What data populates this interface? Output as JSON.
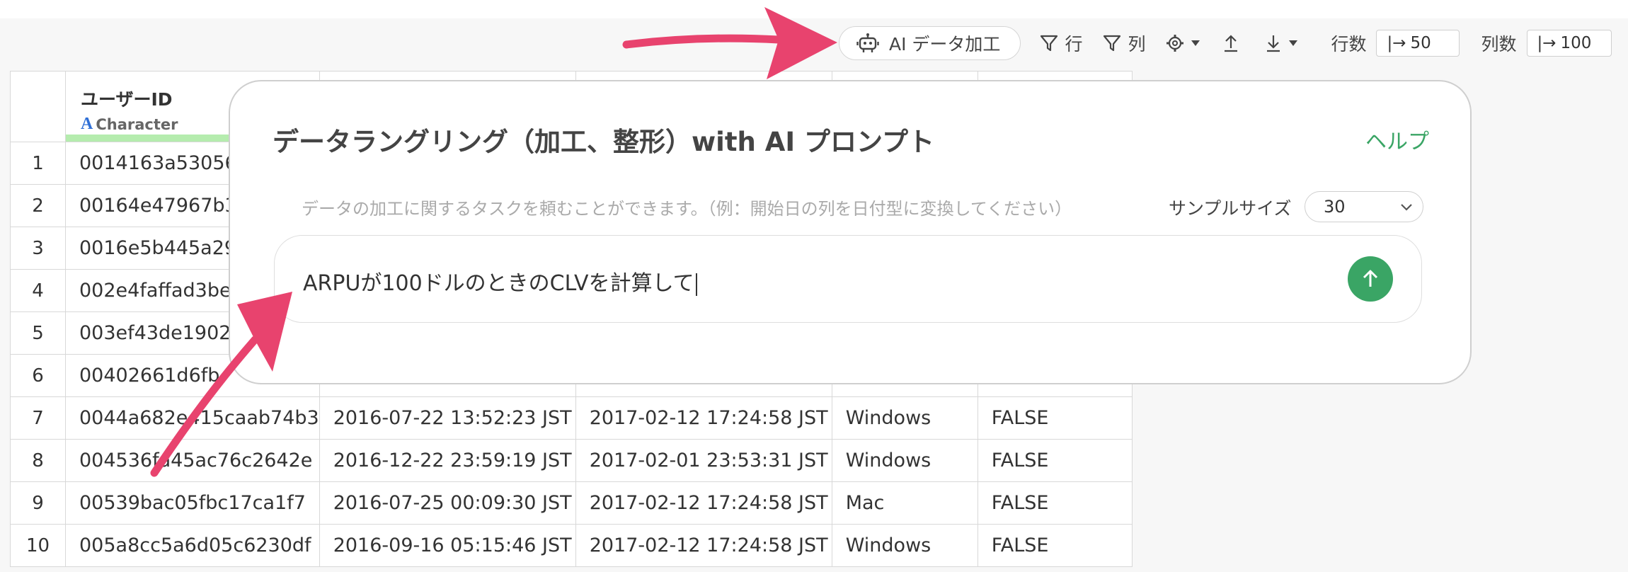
{
  "toolbar": {
    "ai_button_label": "AI データ加工",
    "row_filter_label": "行",
    "col_filter_label": "列",
    "row_count_label": "行数",
    "row_count_value": "50",
    "col_count_label": "列数",
    "col_count_value": "100"
  },
  "table": {
    "first_column": {
      "name": "ユーザーID",
      "type": "Character"
    },
    "rows": [
      {
        "n": "1",
        "c1": "0014163a53056c",
        "c2": "",
        "c3": "",
        "c4": "",
        "c5": ""
      },
      {
        "n": "2",
        "c1": "00164e47967b30",
        "c2": "",
        "c3": "",
        "c4": "",
        "c5": ""
      },
      {
        "n": "3",
        "c1": "0016e5b445a29e",
        "c2": "",
        "c3": "",
        "c4": "",
        "c5": ""
      },
      {
        "n": "4",
        "c1": "002e4faffad3be6",
        "c2": "",
        "c3": "",
        "c4": "",
        "c5": ""
      },
      {
        "n": "5",
        "c1": "003ef43de19023",
        "c2": "",
        "c3": "",
        "c4": "",
        "c5": ""
      },
      {
        "n": "6",
        "c1": "00402661d6fb",
        "c2": "",
        "c3": "",
        "c4": "",
        "c5": ""
      },
      {
        "n": "7",
        "c1": "0044a682e415caab74b3",
        "c2": "2016-07-22 13:52:23 JST",
        "c3": "2017-02-12 17:24:58 JST",
        "c4": "Windows",
        "c5": "FALSE"
      },
      {
        "n": "8",
        "c1": "004536fa45ac76c2642e",
        "c2": "2016-12-22 23:59:19 JST",
        "c3": "2017-02-01 23:53:31 JST",
        "c4": "Windows",
        "c5": "FALSE"
      },
      {
        "n": "9",
        "c1": "00539bac05fbc17ca1f7",
        "c2": "2016-07-25 00:09:30 JST",
        "c3": "2017-02-12 17:24:58 JST",
        "c4": "Mac",
        "c5": "FALSE"
      },
      {
        "n": "10",
        "c1": "005a8cc5a6d05c6230df",
        "c2": "2016-09-16 05:15:46 JST",
        "c3": "2017-02-12 17:24:58 JST",
        "c4": "Windows",
        "c5": "FALSE"
      }
    ]
  },
  "dialog": {
    "title": "データラングリング（加工、整形）with AI プロンプト",
    "help_label": "ヘルプ",
    "hint": "データの加工に関するタスクを頼むことができます。（例：開始日の列を日付型に変換してください）",
    "sample_size_label": "サンプルサイズ",
    "sample_size_value": "30",
    "prompt_value": "ARPUが100ドルのときのCLVを計算して"
  },
  "colors": {
    "accent_green": "#3aa565",
    "arrow_pink": "#e8436e",
    "type_bar": "#b5ecae"
  }
}
